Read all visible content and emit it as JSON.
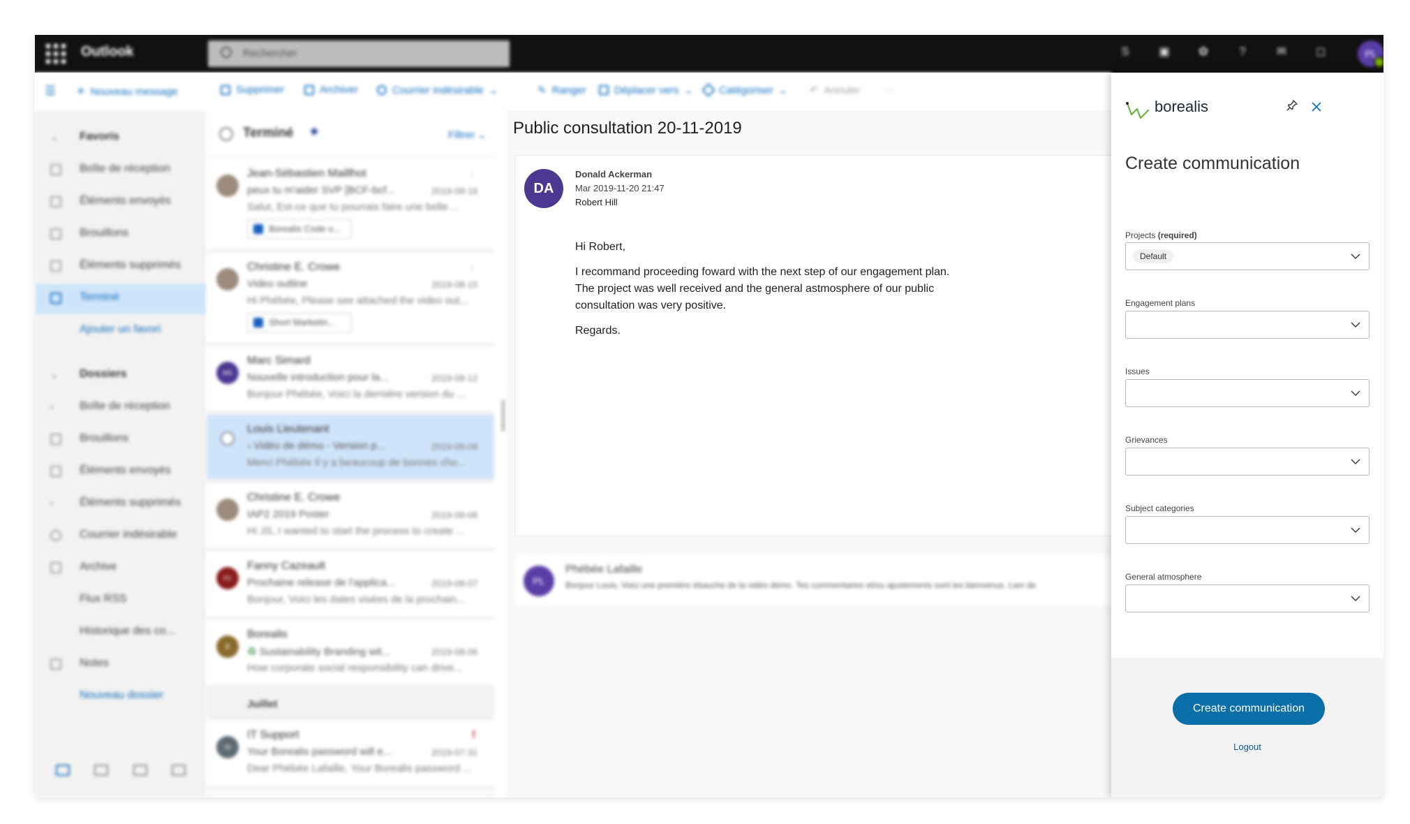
{
  "topbar": {
    "app_name": "Outlook",
    "search_placeholder": "Rechercher",
    "avatar_initials": "PL"
  },
  "commandbar": {
    "new_message": "Nouveau message",
    "delete": "Supprimer",
    "archive": "Archiver",
    "junk": "Courrier indésirable",
    "sweep": "Ranger",
    "move_to": "Déplacer vers",
    "categorize": "Catégoriser",
    "undo": "Annuler",
    "more": "···"
  },
  "leftnav": {
    "favorites_header": "Favoris",
    "favorites": [
      "Boîte de réception",
      "Éléments envoyés",
      "Brouillons",
      "Éléments supprimés",
      "Terminé"
    ],
    "add_favorite": "Ajouter un favori",
    "folders_header": "Dossiers",
    "folders": [
      "Boîte de réception",
      "Brouillons",
      "Éléments envoyés",
      "Éléments supprimés",
      "Courrier indésirable",
      "Archive",
      "Flux RSS",
      "Historique des co...",
      "Notes"
    ],
    "new_folder": "Nouveau dossier"
  },
  "msglist": {
    "folder_title": "Terminé",
    "filter_label": "Filtrer",
    "messages": [
      {
        "initials": "",
        "from": "Jean-Sébastien Maillhot",
        "subject": "peux tu m'aider SVP [BCF-bcf...",
        "date": "2019-08-16",
        "preview": "Salut, Est-ce que tu pourrais faire une belle ...",
        "attachment": "Borealis Code o..."
      },
      {
        "initials": "",
        "from": "Christine E. Crowe",
        "subject": "Video outline",
        "date": "2019-08-15",
        "preview": "Hi Phébée, Please see attached the video out...",
        "attachment": "Short Marketin..."
      },
      {
        "initials": "MS",
        "from": "Marc Simard",
        "subject": "Nouvelle introduction pour la...",
        "date": "2019-08-12",
        "preview": "Bonjour Phébée, Voici la dernière version du ..."
      },
      {
        "initials": "",
        "from": "Louis Lieutenant",
        "subject": "Vidéo de démo - Version p...",
        "date": "2019-08-09",
        "preview": "Merci Phébée Il y a beaucoup de bonnes cho..."
      },
      {
        "initials": "",
        "from": "Christine E. Crowe",
        "subject": "IAP2 2019 Poster",
        "date": "2019-08-06",
        "preview": "Hi JS, I wanted to start the process to create ..."
      },
      {
        "initials": "FC",
        "from": "Fanny Cazeault",
        "subject": "Prochaine release de l'applica...",
        "date": "2019-08-07",
        "preview": "Bonjour, Voici les dates visées de la prochain..."
      },
      {
        "initials": "B",
        "from": "Borealis",
        "subject": "Sustainability Branding wit...",
        "date": "2019-08-06",
        "preview": "How corporate social responsibility can drive..."
      },
      {
        "initials": "IS",
        "from": "IT Support",
        "subject": "Your Borealis password will e...",
        "date": "2019-07-31",
        "preview": "Dear Phébée Lafaille, Your Borealis password ..."
      }
    ],
    "month_separator": "Juillet"
  },
  "reading": {
    "subject": "Public consultation 20-11-2019",
    "sender_initials": "DA",
    "sender_name": "Donald Ackerman",
    "sent_date": "Mar 2019-11-20 21:47",
    "recipient": "Robert Hill",
    "greeting": "Hi Robert,",
    "body_line1": "I recommand proceeding foward with the next step of our engagement plan.",
    "body_line2": "The project was well received and the general astmosphere of our public",
    "body_line3": "consultation was very positive.",
    "closing": "Regards.",
    "reply_initials": "PL",
    "reply_from": "Phébée Lafaille",
    "reply_preview": "Bonjour Louis, Voici une première ébauche de la vidéo démo. Tes commentaires et/ou ajustements sont les bienvenus. Lien de"
  },
  "panel": {
    "brand": "borealis",
    "title": "Create communication",
    "projects_label": "Projects",
    "projects_required": "(required)",
    "projects_value": "Default",
    "engagement_label": "Engagement plans",
    "issues_label": "Issues",
    "grievances_label": "Grievances",
    "subject_categories_label": "Subject categories",
    "general_atmosphere_label": "General atmosphere",
    "create_button": "Create communication",
    "logout": "Logout"
  },
  "colors": {
    "primary_button": "#0a6ea8",
    "link": "#0a5c9c",
    "logo_green": "#6db33f"
  }
}
